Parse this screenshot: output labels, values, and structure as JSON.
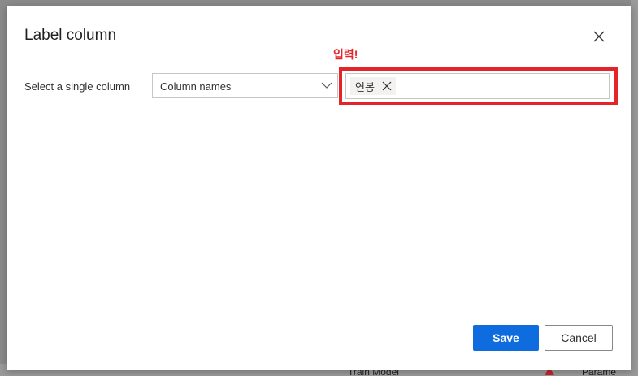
{
  "dialog": {
    "title": "Label column",
    "close_icon": "close-icon",
    "annotation": "입력!",
    "annotation_color": "#e3252b",
    "field": {
      "label": "Select a single column",
      "dropdown_value": "Column names",
      "dropdown_icon": "chevron-down-icon",
      "tags": [
        "연봉"
      ],
      "tag_remove_icon": "close-icon"
    },
    "buttons": {
      "save": "Save",
      "cancel": "Cancel"
    },
    "accent_color": "#0f6cde"
  },
  "background": {
    "items": [
      "Train Model",
      "Parame"
    ],
    "warning_icon": "warning-icon"
  }
}
